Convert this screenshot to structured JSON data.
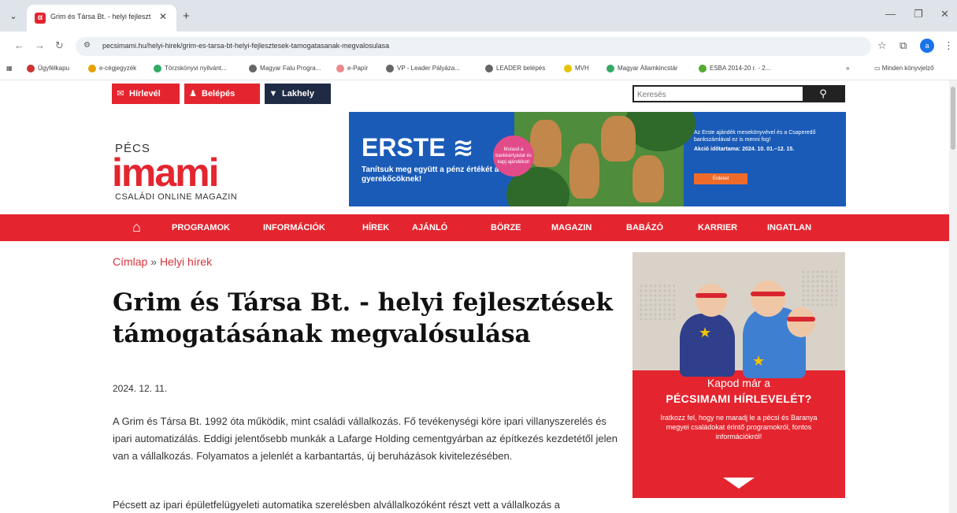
{
  "browser": {
    "tab_title": "Grim és Társa Bt. - helyi fejleszt",
    "tab_close": "✕",
    "new_tab": "+",
    "url": "pecsimami.hu/helyi-hirek/grim-es-tarsa-bt-helyi-fejlesztesek-tamogatasanak-megvalosulasa",
    "profile_initial": "a",
    "bookmarks": [
      "Ügyfélkapu",
      "e-cégjegyzék",
      "Törzskönyvi nyilvánt...",
      "Magyar Falu Progra...",
      "e-Papír",
      "VP - Leader Pályáza...",
      "LEADER belépés",
      "MVH",
      "Magyar Államkincstár",
      "ESBA 2014-20 r. - 2...",
      "»",
      "Minden könyvjelző"
    ]
  },
  "site": {
    "top_buttons": {
      "newsletter": "Hírlevél",
      "login": "Belépés",
      "residence": "Lakhely"
    },
    "search_placeholder": "Keresés",
    "logo": {
      "top": "PÉCS",
      "main": "imami",
      "sub": "CSALÁDI ONLINE MAGAZIN"
    },
    "banner": {
      "brand": "ERSTE",
      "tagline": "Tanítsuk meg együtt a pénz értékét a gyerekőcöknek!",
      "badge": "Mutasd a bankkártyádat és kapj ajándékot!",
      "text1": "Az Erste ajándék mesekönyvével és a Csaperedő bankszámlával ez is menni fog!",
      "text2": "Akció időtartama: 2024. 10. 01.–12. 15.",
      "cta": "Érdekel"
    },
    "nav": [
      "PROGRAMOK",
      "INFORMÁCIÓK",
      "HÍREK",
      "AJÁNLÓ",
      "BÖRZE",
      "MAGAZIN",
      "BABÁZÓ",
      "KARRIER",
      "INGATLAN"
    ]
  },
  "article": {
    "breadcrumb_home": "Címlap",
    "breadcrumb_sep": "»",
    "breadcrumb_section": "Helyi hírek",
    "title": "Grim és Társa Bt. - helyi fejlesztések támogatásának megvalósulása",
    "date": "2024. 12. 11.",
    "paragraph1": "A Grim és Társa Bt. 1992 óta működik, mint családi vállalkozás. Fő tevékenységi köre ipari villanyszerelés és ipari automatizálás. Eddigi jelentősebb munkák a Lafarge Holding cementgyárban az építkezés kezdetétől jelen van a vállalkozás. Folyamatos a jelenlét a karbantartás, új beruházások kivitelezésében.",
    "paragraph2": "Pécsett az ipari épületfelügyeleti automatika szerelésben alvállalkozóként részt vett a vállalkozás a"
  },
  "sidebar_ad": {
    "line1": "Kapod már a",
    "title": "PÉCSIMAMI HÍRLEVELÉT?",
    "desc": "Iratkozz fel, hogy ne maradj le a pécsi és Baranya megyei családokat érintő programokról, fontos információkról!"
  },
  "colors": {
    "brand_red": "#e4252f",
    "banner_blue": "#1a5bb8",
    "link_red": "#d7333a"
  }
}
